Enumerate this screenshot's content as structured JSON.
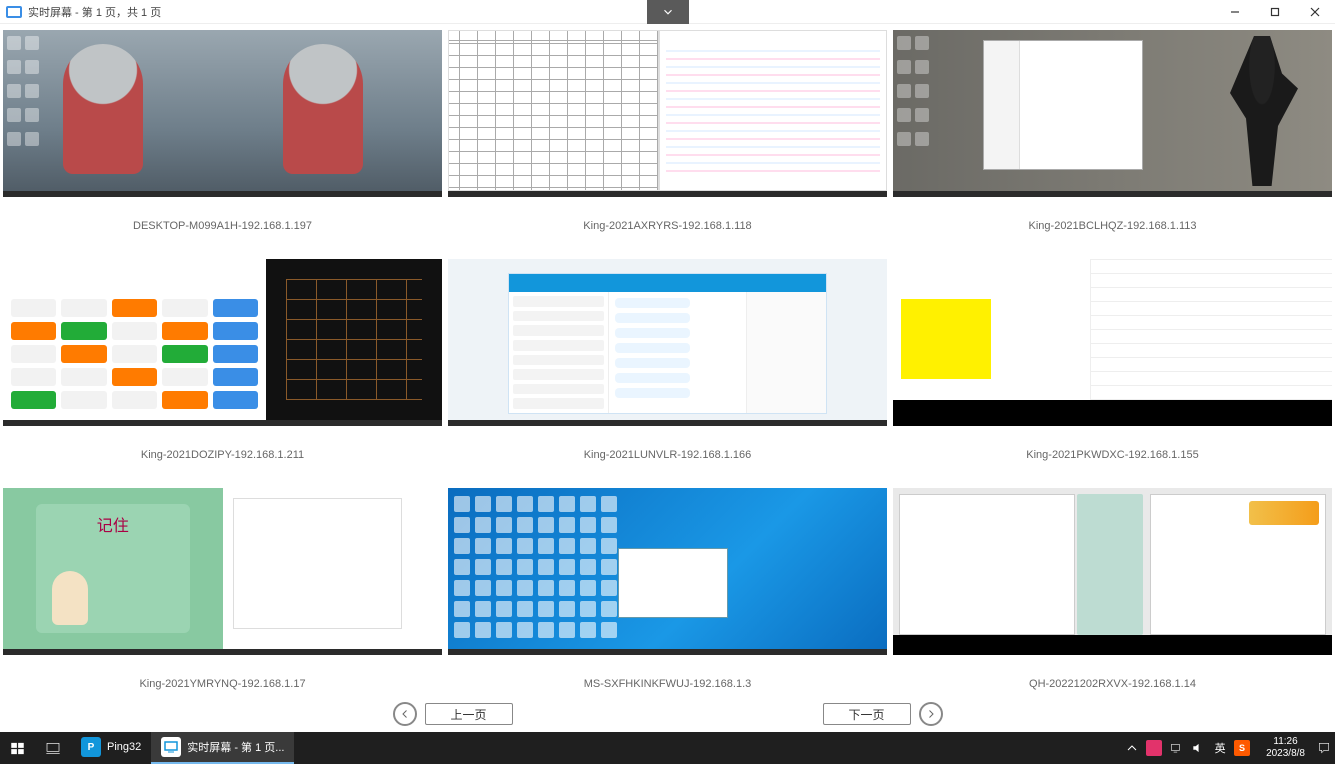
{
  "window": {
    "title": "实时屏幕 - 第 1 页，共 1 页"
  },
  "screens": [
    {
      "label": "DESKTOP-M099A1H-192.168.1.197",
      "t": "t1"
    },
    {
      "label": "King-2021AXRYRS-192.168.1.118",
      "t": "t2"
    },
    {
      "label": "King-2021BCLHQZ-192.168.1.113",
      "t": "t3"
    },
    {
      "label": "King-2021DOZIPY-192.168.1.211",
      "t": "t4"
    },
    {
      "label": "King-2021LUNVLR-192.168.1.166",
      "t": "t5"
    },
    {
      "label": "King-2021PKWDXC-192.168.1.155",
      "t": "t6"
    },
    {
      "label": "King-2021YMRYNQ-192.168.1.17",
      "t": "t7"
    },
    {
      "label": "MS-SXFHKINKFWUJ-192.168.1.3",
      "t": "t8"
    },
    {
      "label": "QH-20221202RXVX-192.168.1.14",
      "t": "t9"
    }
  ],
  "thumb7_title": "记住",
  "pager": {
    "prev": "上一页",
    "next": "下一页"
  },
  "taskbar": {
    "app1": "Ping32",
    "app2": "实时屏幕 - 第 1 页...",
    "ime": "英",
    "time": "11:26",
    "date": "2023/8/8"
  }
}
